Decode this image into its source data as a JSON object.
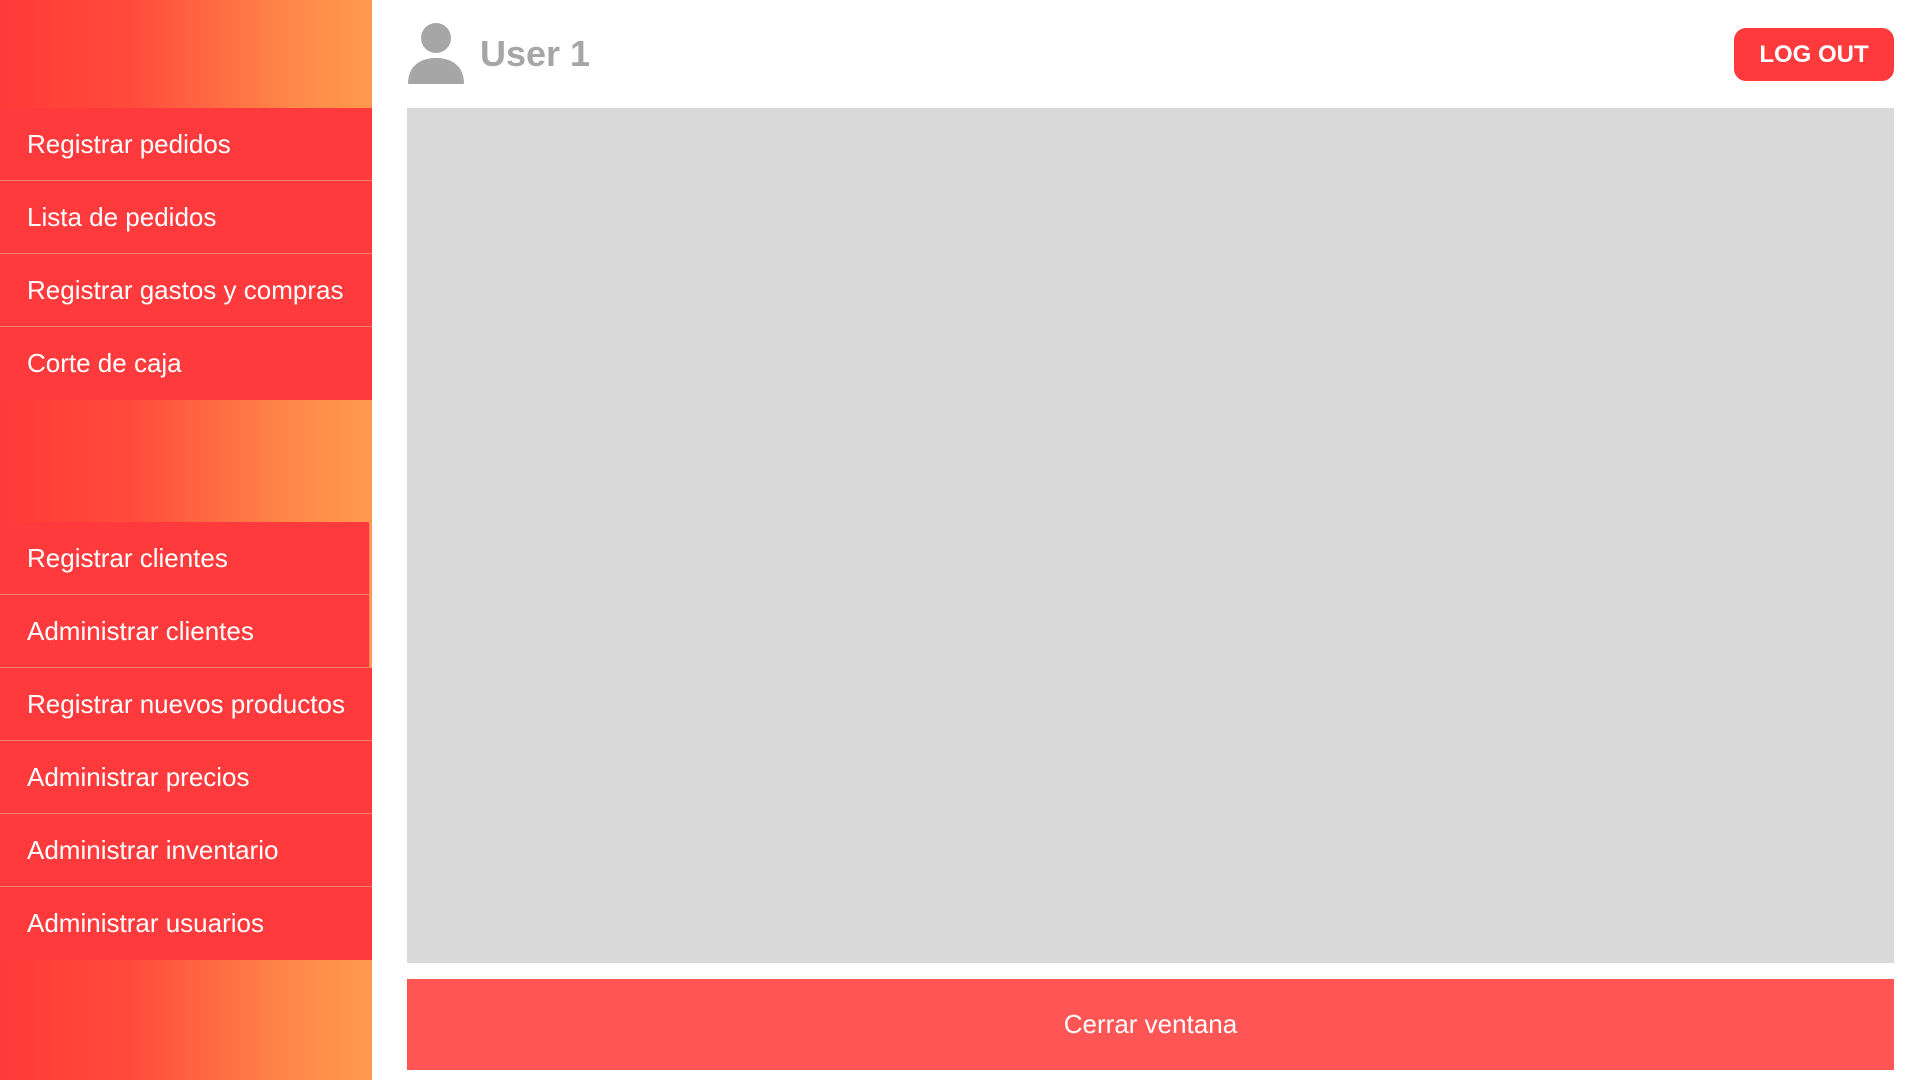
{
  "user": {
    "name": "User 1",
    "icon": "user-icon"
  },
  "header": {
    "logout_label": "LOG OUT"
  },
  "sidebar": {
    "group1": [
      {
        "label": "Registrar pedidos"
      },
      {
        "label": "Lista de pedidos"
      },
      {
        "label": "Registrar gastos y compras"
      },
      {
        "label": "Corte de caja"
      }
    ],
    "group2": [
      {
        "label": "Registrar clientes"
      },
      {
        "label": "Administrar clientes"
      },
      {
        "label": "Registrar nuevos productos"
      },
      {
        "label": "Administrar precios"
      },
      {
        "label": "Administrar inventario"
      },
      {
        "label": "Administrar usuarios"
      }
    ]
  },
  "footer": {
    "close_label": "Cerrar ventana"
  },
  "colors": {
    "accent": "#ff3a3d",
    "close_button": "#ff5555",
    "panel": "#d9d9d9",
    "gradient_start": "#ff3a3a",
    "gradient_end": "#ff9a4c"
  }
}
